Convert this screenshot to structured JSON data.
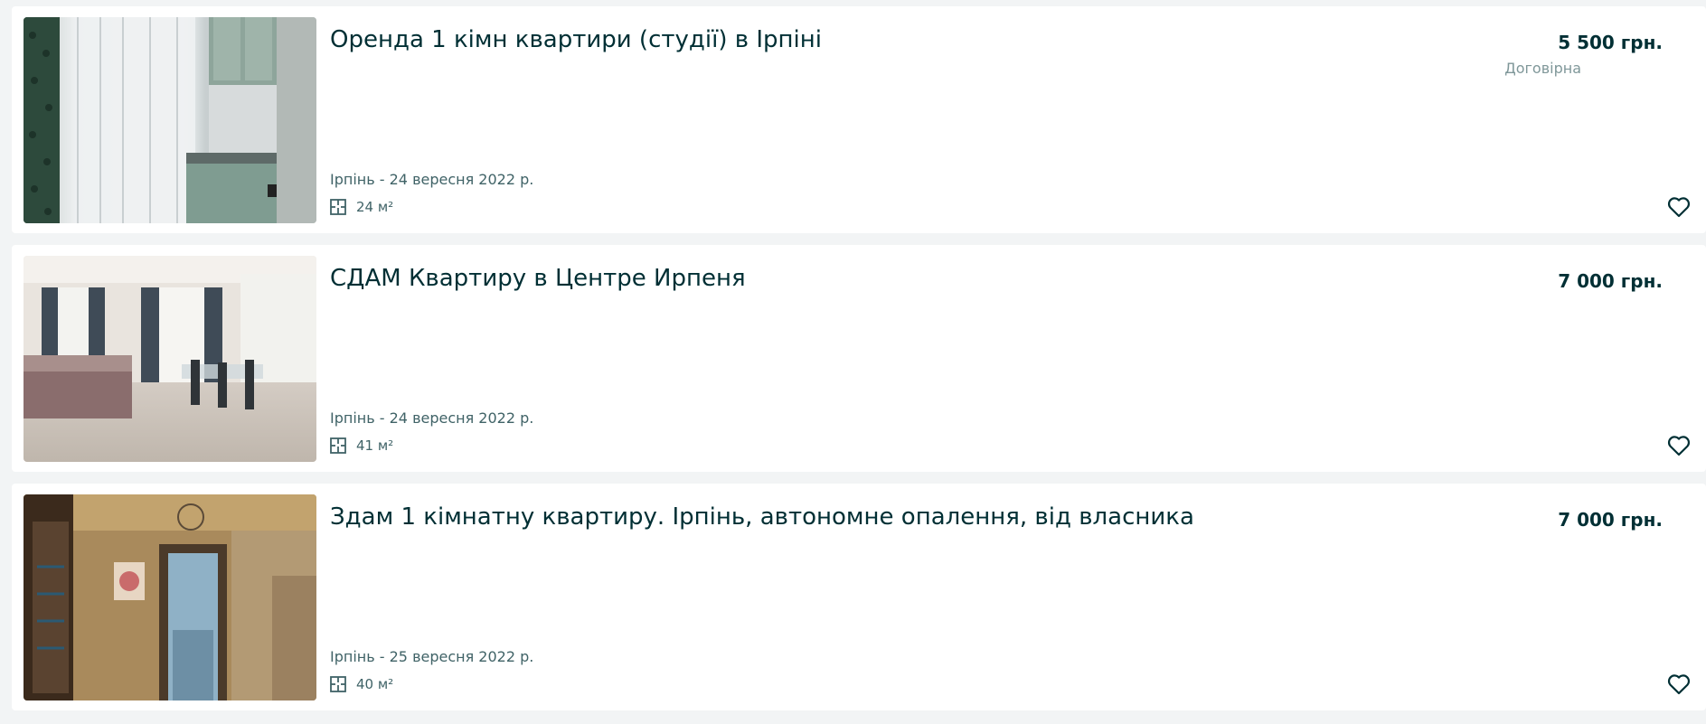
{
  "listings": [
    {
      "title": "Оренда 1 кімн квартири (студії) в Ірпіні",
      "price": "5 500 грн.",
      "negotiable": "Договірна",
      "location_date": "Ірпінь - 24 вересня 2022 р.",
      "area": "24 м²"
    },
    {
      "title": "СДАМ Квартиру в Центре Ирпеня",
      "price": "7 000 грн.",
      "negotiable": "",
      "location_date": "Ірпінь - 24 вересня 2022 р.",
      "area": "41 м²"
    },
    {
      "title": "Здам 1 кімнатну квартиру. Ірпінь, автономне опалення, від власника",
      "price": "7 000 грн.",
      "negotiable": "",
      "location_date": "Ірпінь - 25 вересня 2022 р.",
      "area": "40 м²"
    }
  ],
  "icons": {
    "area": "floor-plan-icon",
    "favorite": "heart-outline-icon"
  },
  "colors": {
    "text_primary": "#002f34",
    "text_secondary": "#406367",
    "text_muted": "#7f9799",
    "page_bg": "#f2f4f5"
  }
}
